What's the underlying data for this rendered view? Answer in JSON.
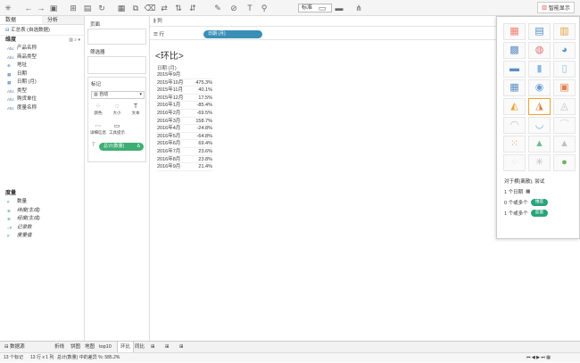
{
  "toolbar": {
    "marks_type": "标准",
    "show_me_label": "智能显示"
  },
  "left_pane": {
    "tabs": [
      "数据",
      "分析"
    ],
    "datasource": "汇总表 (自选数据)",
    "dimensions_title": "维度",
    "dimensions": [
      {
        "type": "Abc",
        "name": "产品名称"
      },
      {
        "type": "Abc",
        "name": "商品类型"
      },
      {
        "type": "⊕",
        "name": "地址"
      },
      {
        "type": "▦",
        "name": "日期"
      },
      {
        "type": "▦",
        "name": "日期 (月)"
      },
      {
        "type": "Abc",
        "name": "类型"
      },
      {
        "type": "Abc",
        "name": "购货单位"
      },
      {
        "type": "Abc",
        "name": "度量名称"
      }
    ],
    "measures_title": "度量",
    "measures": [
      {
        "type": "#",
        "name": "数量"
      },
      {
        "type": "⊕",
        "name": "纬度(生成)"
      },
      {
        "type": "⊕",
        "name": "经度(生成)"
      },
      {
        "type": "=#",
        "name": "记录数"
      },
      {
        "type": "#",
        "name": "度量值"
      }
    ]
  },
  "shelves": {
    "pages": "页面",
    "filters": "筛选器",
    "marks": "标记",
    "mark_type": "自动",
    "mark_buttons": [
      {
        "icon": "⁘",
        "label": "颜色"
      },
      {
        "icon": "◌",
        "label": "大小"
      },
      {
        "icon": "T",
        "label": "文本"
      },
      {
        "icon": "⋯",
        "label": "详细信息"
      },
      {
        "icon": "▭",
        "label": "工具提示"
      }
    ],
    "mark_pill": "总计(数量)"
  },
  "columns_label": "列",
  "rows_label": "行",
  "rows_pill": "日期 (月)",
  "view": {
    "title": "<环比>",
    "header": "日期 (月)",
    "rows": [
      {
        "date": "2015年9月",
        "value": ""
      },
      {
        "date": "2015年10月",
        "value": "475.3%"
      },
      {
        "date": "2015年11月",
        "value": "40.1%"
      },
      {
        "date": "2015年12月",
        "value": "17.5%"
      },
      {
        "date": "2016年1月",
        "value": "-85.4%"
      },
      {
        "date": "2016年2月",
        "value": "-69.5%"
      },
      {
        "date": "2016年3月",
        "value": "158.7%"
      },
      {
        "date": "2016年4月",
        "value": "-24.8%"
      },
      {
        "date": "2016年5月",
        "value": "-64.8%"
      },
      {
        "date": "2016年6月",
        "value": "69.4%"
      },
      {
        "date": "2016年7月",
        "value": "23.6%"
      },
      {
        "date": "2016年8月",
        "value": "23.8%"
      },
      {
        "date": "2016年9月",
        "value": "21.4%"
      }
    ]
  },
  "show_me": {
    "hint_title": "对于横(离散), 尝试",
    "hints": [
      {
        "count": "1 个日期",
        "pill": ""
      },
      {
        "count": "0 个或多个",
        "pill": "维度"
      },
      {
        "count": "1 个或多个",
        "pill": "度量"
      }
    ]
  },
  "sheet_tabs": [
    "数据源",
    "折线",
    "饼图",
    "地图",
    "top10",
    "环比",
    "同比"
  ],
  "active_sheet": "环比",
  "status": {
    "marks": "13 个标记",
    "rows_cols": "13 行 x 1 列",
    "sum": "总计(数量) 中的差异 %: 585.2%"
  }
}
